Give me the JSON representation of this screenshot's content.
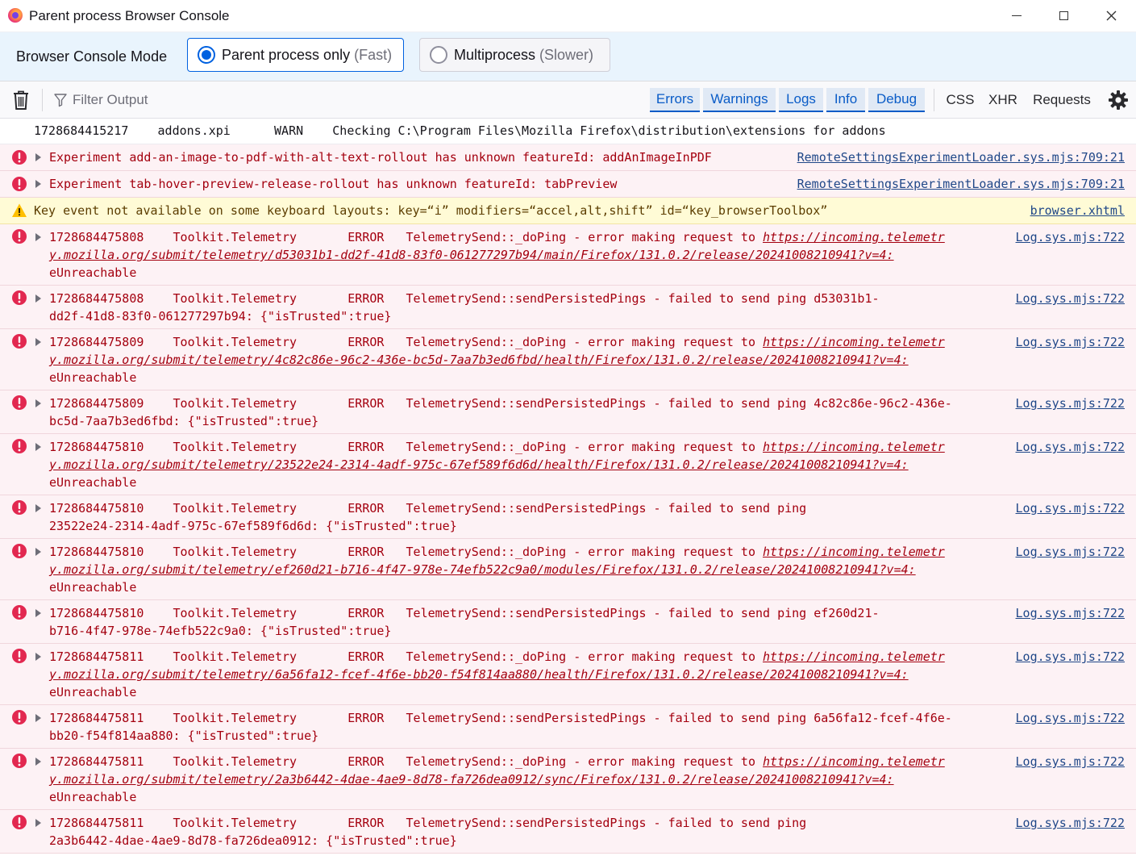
{
  "window": {
    "title": "Parent process Browser Console"
  },
  "mode_bar": {
    "label": "Browser Console Mode",
    "option1_label": "Parent process only",
    "option1_hint": "(Fast)",
    "option2_label": "Multiprocess",
    "option2_hint": "(Slower)"
  },
  "toolbar": {
    "filter_placeholder": "Filter Output",
    "filters": [
      "Errors",
      "Warnings",
      "Logs",
      "Info",
      "Debug"
    ],
    "extra_filters": [
      "CSS",
      "XHR",
      "Requests"
    ]
  },
  "log": {
    "plain_row": "1728684415217    addons.xpi      WARN    Checking C:\\Program Files\\Mozilla Firefox\\distribution\\extensions for addons",
    "rows": [
      {
        "line1": "Experiment add-an-image-to-pdf-with-alt-text-rollout has unknown featureId: addAnImageInPDF",
        "source": "RemoteSettingsExperimentLoader.sys.mjs:709:21"
      },
      {
        "line1": "Experiment tab-hover-preview-release-rollout has unknown featureId: tabPreview",
        "source": "RemoteSettingsExperimentLoader.sys.mjs:709:21"
      },
      {
        "line1": "Key event not available on some keyboard layouts: key=“i” modifiers=“accel,alt,shift” id=“key_browserToolbox”",
        "source": "browser.xhtml"
      },
      {
        "line1": "1728684475808    Toolkit.Telemetry       ERROR   TelemetrySend::_doPing - error making request to ",
        "url1": "https://incoming.telemetr",
        "url2": "y.mozilla.org/submit/telemetry/d53031b1-dd2f-41d8-83f0-061277297b94/main/Firefox/131.0.2/release/20241008210941?v=4:",
        "line3": "eUnreachable",
        "source": "Log.sys.mjs:722"
      },
      {
        "line1": "1728684475808    Toolkit.Telemetry       ERROR   TelemetrySend::sendPersistedPings - failed to send ping d53031b1-",
        "line2": "dd2f-41d8-83f0-061277297b94: {\"isTrusted\":true}",
        "source": "Log.sys.mjs:722"
      },
      {
        "line1": "1728684475809    Toolkit.Telemetry       ERROR   TelemetrySend::_doPing - error making request to ",
        "url1": "https://incoming.telemetr",
        "url2": "y.mozilla.org/submit/telemetry/4c82c86e-96c2-436e-bc5d-7aa7b3ed6fbd/health/Firefox/131.0.2/release/20241008210941?v=4:",
        "line3": "eUnreachable",
        "source": "Log.sys.mjs:722"
      },
      {
        "line1": "1728684475809    Toolkit.Telemetry       ERROR   TelemetrySend::sendPersistedPings - failed to send ping 4c82c86e-96c2-436e-",
        "line2": "bc5d-7aa7b3ed6fbd: {\"isTrusted\":true}",
        "source": "Log.sys.mjs:722"
      },
      {
        "line1": "1728684475810    Toolkit.Telemetry       ERROR   TelemetrySend::_doPing - error making request to ",
        "url1": "https://incoming.telemetr",
        "url2": "y.mozilla.org/submit/telemetry/23522e24-2314-4adf-975c-67ef589f6d6d/health/Firefox/131.0.2/release/20241008210941?v=4:",
        "line3": "eUnreachable",
        "source": "Log.sys.mjs:722"
      },
      {
        "line1": "1728684475810    Toolkit.Telemetry       ERROR   TelemetrySend::sendPersistedPings - failed to send ping",
        "line2": "23522e24-2314-4adf-975c-67ef589f6d6d: {\"isTrusted\":true}",
        "source": "Log.sys.mjs:722"
      },
      {
        "line1": "1728684475810    Toolkit.Telemetry       ERROR   TelemetrySend::_doPing - error making request to ",
        "url1": "https://incoming.telemetr",
        "url2": "y.mozilla.org/submit/telemetry/ef260d21-b716-4f47-978e-74efb522c9a0/modules/Firefox/131.0.2/release/20241008210941?v=4:",
        "line3": "eUnreachable",
        "source": "Log.sys.mjs:722"
      },
      {
        "line1": "1728684475810    Toolkit.Telemetry       ERROR   TelemetrySend::sendPersistedPings - failed to send ping ef260d21-",
        "line2": "b716-4f47-978e-74efb522c9a0: {\"isTrusted\":true}",
        "source": "Log.sys.mjs:722"
      },
      {
        "line1": "1728684475811    Toolkit.Telemetry       ERROR   TelemetrySend::_doPing - error making request to ",
        "url1": "https://incoming.telemetr",
        "url2": "y.mozilla.org/submit/telemetry/6a56fa12-fcef-4f6e-bb20-f54f814aa880/health/Firefox/131.0.2/release/20241008210941?v=4:",
        "line3": "eUnreachable",
        "source": "Log.sys.mjs:722"
      },
      {
        "line1": "1728684475811    Toolkit.Telemetry       ERROR   TelemetrySend::sendPersistedPings - failed to send ping 6a56fa12-fcef-4f6e-",
        "line2": "bb20-f54f814aa880: {\"isTrusted\":true}",
        "source": "Log.sys.mjs:722"
      },
      {
        "line1": "1728684475811    Toolkit.Telemetry       ERROR   TelemetrySend::_doPing - error making request to ",
        "url1": "https://incoming.telemetr",
        "url2": "y.mozilla.org/submit/telemetry/2a3b6442-4dae-4ae9-8d78-fa726dea0912/sync/Firefox/131.0.2/release/20241008210941?v=4:",
        "line3": "eUnreachable",
        "source": "Log.sys.mjs:722"
      },
      {
        "line1": "1728684475811    Toolkit.Telemetry       ERROR   TelemetrySend::sendPersistedPings - failed to send ping",
        "line2": "2a3b6442-4dae-4ae9-8d78-fa726dea0912: {\"isTrusted\":true}",
        "source": "Log.sys.mjs:722"
      }
    ]
  }
}
